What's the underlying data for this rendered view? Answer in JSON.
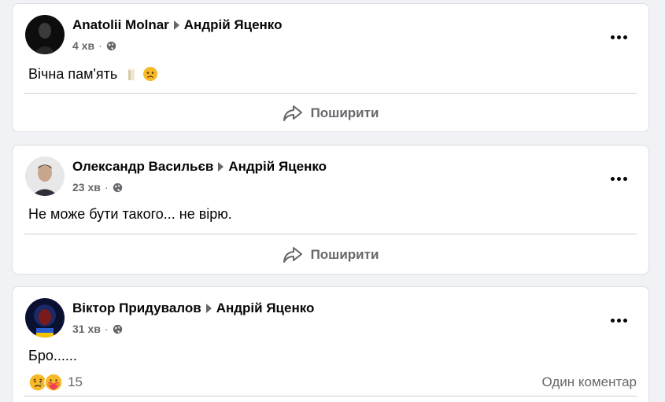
{
  "posts": [
    {
      "author": "Anatolii Molnar",
      "target": "Андрій Яценко",
      "time": "4 хв",
      "text": "Вічна пам'ять",
      "emojis": [
        "candle-emoji",
        "sad-face-emoji"
      ],
      "share_label": "Поширити"
    },
    {
      "author": "Олександр Васильєв",
      "target": "Андрій Яценко",
      "time": "23 хв",
      "text": "Не може бути такого... не вірю.",
      "share_label": "Поширити"
    },
    {
      "author": "Віктор Придувалов",
      "target": "Андрій Яценко",
      "time": "31 хв",
      "text": "Бро......",
      "reactions": [
        "sad-reaction",
        "care-reaction"
      ],
      "reaction_count": "15",
      "comments_label": "Один коментар"
    }
  ],
  "meta_separator": "·",
  "colors": {
    "background": "#f0f2f5",
    "card": "#ffffff",
    "secondary_text": "#65676b",
    "divider": "#ced0d4"
  }
}
